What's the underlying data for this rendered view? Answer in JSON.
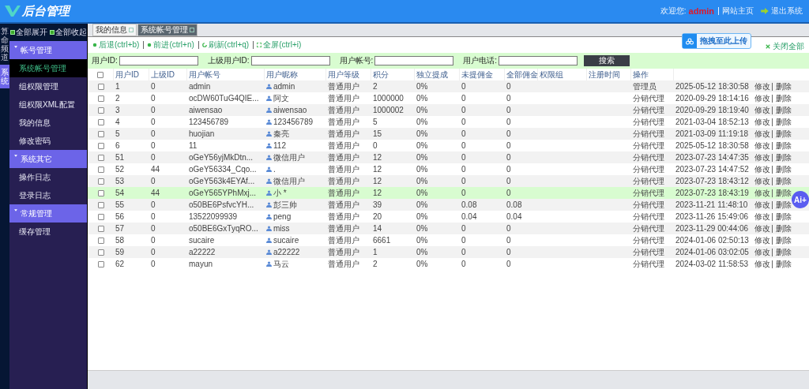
{
  "header": {
    "logo": "后台管理",
    "welcome": "欢迎您:",
    "user": "admin",
    "home_link": "网站主页",
    "logout": "退出系统"
  },
  "side_tabs": [
    {
      "label": "算命频道",
      "selected": false
    },
    {
      "label": "系统",
      "selected": true
    }
  ],
  "tree_actions": [
    "全部展开",
    "全部收起"
  ],
  "menu": [
    {
      "label": "帐号管理",
      "expanded": true,
      "children": [
        {
          "label": "系统帐号管理",
          "selected": true
        },
        {
          "label": "组权限管理",
          "selected": false
        },
        {
          "label": "组权限XML配置",
          "selected": false
        },
        {
          "label": "我的信息",
          "selected": false
        },
        {
          "label": "修改密码",
          "selected": false
        }
      ]
    },
    {
      "label": "系统其它",
      "expanded": true,
      "children": [
        {
          "label": "操作日志",
          "selected": false
        },
        {
          "label": "登录日志",
          "selected": false
        }
      ]
    },
    {
      "label": "常规管理",
      "expanded": true,
      "children": [
        {
          "label": "缓存管理",
          "selected": false
        }
      ]
    }
  ],
  "tabs": [
    {
      "label": "我的信息",
      "selected": false
    },
    {
      "label": "系统帐号管理",
      "selected": true
    }
  ],
  "toolbar": [
    {
      "label": "后退(ctrl+b)",
      "kind": "back"
    },
    {
      "label": "前进(ctrl+n)",
      "kind": "forward"
    },
    {
      "label": "刷新(ctrl+q)",
      "kind": "refresh"
    },
    {
      "label": "全屏(ctrl+i)",
      "kind": "fullscreen"
    }
  ],
  "upload_badge": "拖拽至此上传",
  "close_all": "关闭全部",
  "search": {
    "fields": [
      "用户ID:",
      "上级用户ID:",
      "用户帐号:",
      "用户电话:"
    ],
    "button": "搜索"
  },
  "table": {
    "select_all_checked": false,
    "columns": [
      "用户ID",
      "上级ID",
      "用户帐号",
      "用户昵称",
      "用户等级",
      "积分",
      "独立提成",
      "未提佣金",
      "全部佣金",
      "权限组",
      "注册时间",
      "操作"
    ],
    "rows": [
      {
        "checked": false,
        "id": "1",
        "parent": "0",
        "account": "admin",
        "nickname": "admin",
        "level": "普通用户",
        "points": "2",
        "commission": "0%",
        "unpaid": "0",
        "total": "0",
        "role": "管理员",
        "time": "2025-05-12 18:30:58",
        "actions": [
          "修改",
          "删除"
        ],
        "highlighted": false
      },
      {
        "checked": false,
        "id": "2",
        "parent": "0",
        "account": "ocDW60TuG4QIE...",
        "nickname": "阿文",
        "level": "普通用户",
        "points": "1000000",
        "commission": "0%",
        "unpaid": "0",
        "total": "0",
        "role": "分销代理",
        "time": "2020-09-29 18:14:16",
        "actions": [
          "修改",
          "删除"
        ],
        "highlighted": false
      },
      {
        "checked": false,
        "id": "3",
        "parent": "0",
        "account": "aiwensao",
        "nickname": "aiwensao",
        "level": "普通用户",
        "points": "1000002",
        "commission": "0%",
        "unpaid": "0",
        "total": "0",
        "role": "分销代理",
        "time": "2020-09-29 18:19:40",
        "actions": [
          "修改",
          "删除"
        ],
        "highlighted": false
      },
      {
        "checked": false,
        "id": "4",
        "parent": "0",
        "account": "123456789",
        "nickname": "123456789",
        "level": "普通用户",
        "points": "5",
        "commission": "0%",
        "unpaid": "0",
        "total": "0",
        "role": "分销代理",
        "time": "2021-03-04 18:52:13",
        "actions": [
          "修改",
          "删除"
        ],
        "highlighted": false
      },
      {
        "checked": false,
        "id": "5",
        "parent": "0",
        "account": "huojian",
        "nickname": "秦亮",
        "level": "普通用户",
        "points": "15",
        "commission": "0%",
        "unpaid": "0",
        "total": "0",
        "role": "分销代理",
        "time": "2021-03-09 11:19:18",
        "actions": [
          "修改",
          "删除"
        ],
        "highlighted": false
      },
      {
        "checked": false,
        "id": "6",
        "parent": "0",
        "account": "11",
        "nickname": "112",
        "level": "普通用户",
        "points": "0",
        "commission": "0%",
        "unpaid": "0",
        "total": "0",
        "role": "分销代理",
        "time": "2025-05-12 18:30:58",
        "actions": [
          "修改",
          "删除"
        ],
        "highlighted": false
      },
      {
        "checked": false,
        "id": "51",
        "parent": "0",
        "account": "oGeY56yjMkDtn...",
        "nickname": "微信用户",
        "level": "普通用户",
        "points": "12",
        "commission": "0%",
        "unpaid": "0",
        "total": "0",
        "role": "分销代理",
        "time": "2023-07-23 14:47:35",
        "actions": [
          "修改",
          "删除"
        ],
        "highlighted": false
      },
      {
        "checked": false,
        "id": "52",
        "parent": "44",
        "account": "oGeY56334_Cqo...",
        "nickname": ".",
        "level": "普通用户",
        "points": "12",
        "commission": "0%",
        "unpaid": "0",
        "total": "0",
        "role": "分销代理",
        "time": "2023-07-23 14:47:52",
        "actions": [
          "修改",
          "删除"
        ],
        "highlighted": false
      },
      {
        "checked": false,
        "id": "53",
        "parent": "0",
        "account": "oGeY563k4EYAf...",
        "nickname": "微信用户",
        "level": "普通用户",
        "points": "12",
        "commission": "0%",
        "unpaid": "0",
        "total": "0",
        "role": "分销代理",
        "time": "2023-07-23 18:43:12",
        "actions": [
          "修改",
          "删除"
        ],
        "highlighted": false
      },
      {
        "checked": false,
        "id": "54",
        "parent": "44",
        "account": "oGeY565YPhMxj...",
        "nickname": "小 *",
        "level": "普通用户",
        "points": "12",
        "commission": "0%",
        "unpaid": "0",
        "total": "0",
        "role": "分销代理",
        "time": "2023-07-23 18:43:19",
        "actions": [
          "修改",
          "删除"
        ],
        "highlighted": true
      },
      {
        "checked": false,
        "id": "55",
        "parent": "0",
        "account": "o50BE6PsfvcYH...",
        "nickname": "彭三帅",
        "level": "普通用户",
        "points": "39",
        "commission": "0%",
        "unpaid": "0.08",
        "total": "0.08",
        "role": "分销代理",
        "time": "2023-11-21 11:48:10",
        "actions": [
          "修改",
          "删除"
        ],
        "highlighted": false
      },
      {
        "checked": false,
        "id": "56",
        "parent": "0",
        "account": "13522099939",
        "nickname": "peng",
        "level": "普通用户",
        "points": "20",
        "commission": "0%",
        "unpaid": "0.04",
        "total": "0.04",
        "role": "分销代理",
        "time": "2023-11-26 15:49:06",
        "actions": [
          "修改",
          "删除"
        ],
        "highlighted": false
      },
      {
        "checked": false,
        "id": "57",
        "parent": "0",
        "account": "o50BE6GxTyqRO...",
        "nickname": "miss",
        "level": "普通用户",
        "points": "14",
        "commission": "0%",
        "unpaid": "0",
        "total": "0",
        "role": "分销代理",
        "time": "2023-11-29 00:44:06",
        "actions": [
          "修改",
          "删除"
        ],
        "highlighted": false
      },
      {
        "checked": false,
        "id": "58",
        "parent": "0",
        "account": "sucaire",
        "nickname": "sucaire",
        "level": "普通用户",
        "points": "6661",
        "commission": "0%",
        "unpaid": "0",
        "total": "0",
        "role": "分销代理",
        "time": "2024-01-06 02:50:13",
        "actions": [
          "修改",
          "删除"
        ],
        "highlighted": false
      },
      {
        "checked": false,
        "id": "59",
        "parent": "0",
        "account": "a22222",
        "nickname": "a22222",
        "level": "普通用户",
        "points": "1",
        "commission": "0%",
        "unpaid": "0",
        "total": "0",
        "role": "分销代理",
        "time": "2024-01-06 03:02:05",
        "actions": [
          "修改",
          "删除"
        ],
        "highlighted": false
      },
      {
        "checked": false,
        "id": "62",
        "parent": "0",
        "account": "mayun",
        "nickname": "马云",
        "level": "普通用户",
        "points": "2",
        "commission": "0%",
        "unpaid": "0",
        "total": "0",
        "role": "分销代理",
        "time": "2024-03-02 11:58:53",
        "actions": [
          "修改",
          "删除"
        ],
        "highlighted": false
      }
    ]
  },
  "ai_button": "Ai+"
}
